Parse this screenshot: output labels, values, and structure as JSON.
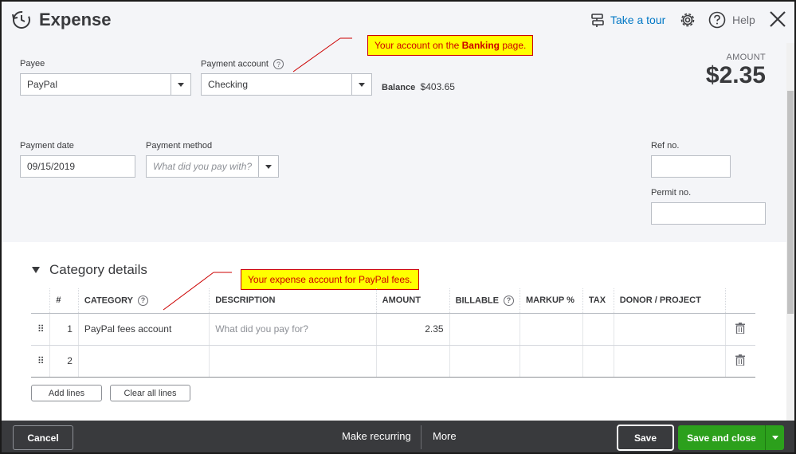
{
  "header": {
    "title": "Expense",
    "tour_label": "Take a tour",
    "help_label": "Help"
  },
  "form": {
    "payee": {
      "label": "Payee",
      "value": "PayPal"
    },
    "payment_account": {
      "label": "Payment account",
      "value": "Checking"
    },
    "balance": {
      "label": "Balance",
      "value": "$403.65"
    },
    "amount": {
      "label": "AMOUNT",
      "value": "$2.35"
    },
    "payment_date": {
      "label": "Payment date",
      "value": "09/15/2019"
    },
    "payment_method": {
      "label": "Payment method",
      "placeholder": "What did you pay with?"
    },
    "ref_no": {
      "label": "Ref no.",
      "value": ""
    },
    "permit_no": {
      "label": "Permit no.",
      "value": ""
    }
  },
  "callouts": {
    "banking": {
      "prefix": "Your account on the ",
      "bold": "Banking",
      "suffix": " page."
    },
    "expense": {
      "text": "Your expense account for PayPal fees."
    }
  },
  "category": {
    "title": "Category details",
    "columns": [
      "#",
      "CATEGORY",
      "DESCRIPTION",
      "AMOUNT",
      "BILLABLE",
      "MARKUP %",
      "TAX",
      "DONOR / PROJECT"
    ],
    "rows": [
      {
        "num": "1",
        "category": "PayPal fees account",
        "description_placeholder": "What did you pay for?",
        "amount": "2.35"
      },
      {
        "num": "2",
        "category": "",
        "description_placeholder": "",
        "amount": ""
      }
    ],
    "add_lines": "Add lines",
    "clear_lines": "Clear all lines"
  },
  "footer": {
    "cancel": "Cancel",
    "make_recurring": "Make recurring",
    "more": "More",
    "save": "Save",
    "save_and_close": "Save and close"
  },
  "colors": {
    "accent_link": "#0077c5",
    "save_green": "#2ca01c",
    "footer_bg": "#393a3d",
    "callout_bg": "#ffff00",
    "callout_text": "#cc0000"
  }
}
